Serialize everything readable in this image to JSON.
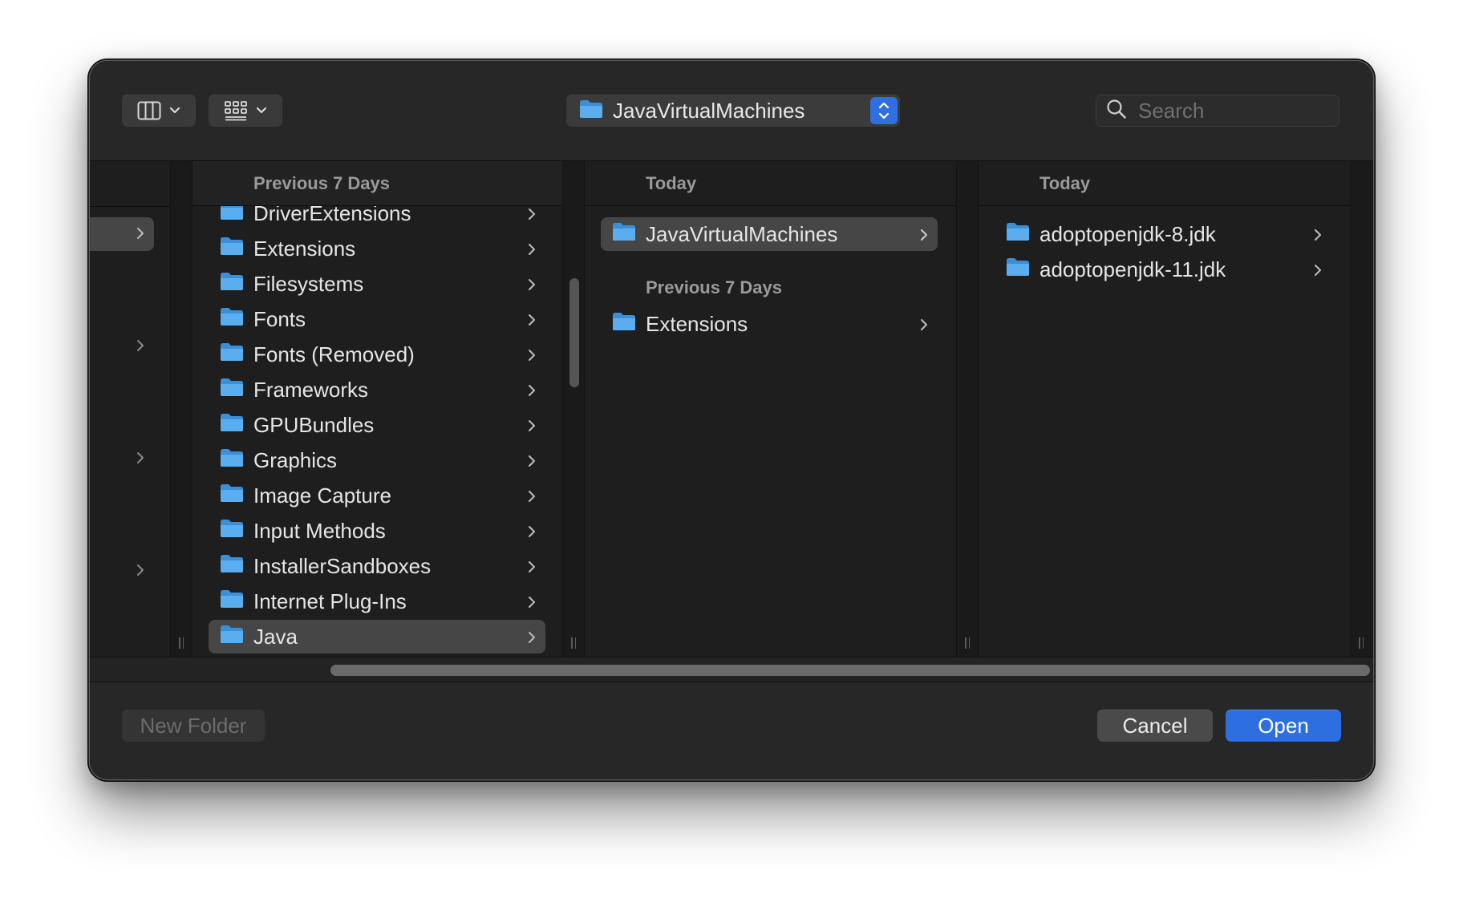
{
  "toolbar": {
    "view_mode_icon": "columns-view-icon",
    "group_icon": "icon-grid-icon",
    "path_popup_label": "JavaVirtualMachines",
    "search_placeholder": "Search"
  },
  "columns": {
    "library": {
      "header": "Previous 7 Days",
      "items": [
        "DriverExtensions",
        "Extensions",
        "Filesystems",
        "Fonts",
        "Fonts (Removed)",
        "Frameworks",
        "GPUBundles",
        "Graphics",
        "Image Capture",
        "Input Methods",
        "InstallerSandboxes",
        "Internet Plug-Ins",
        "Java"
      ],
      "selected": "Java"
    },
    "java": {
      "header": "Today",
      "today_items": [
        "JavaVirtualMachines"
      ],
      "subheader": "Previous 7 Days",
      "previous_items": [
        "Extensions"
      ],
      "selected": "JavaVirtualMachines"
    },
    "jvms": {
      "header": "Today",
      "items": [
        "adoptopenjdk-8.jdk",
        "adoptopenjdk-11.jdk"
      ]
    }
  },
  "buttons": {
    "new_folder": "New Folder",
    "cancel": "Cancel",
    "open": "Open"
  },
  "colors": {
    "accent": "#2d6fe0",
    "folder": "#5aaef0",
    "background": "#1e1e1e"
  }
}
